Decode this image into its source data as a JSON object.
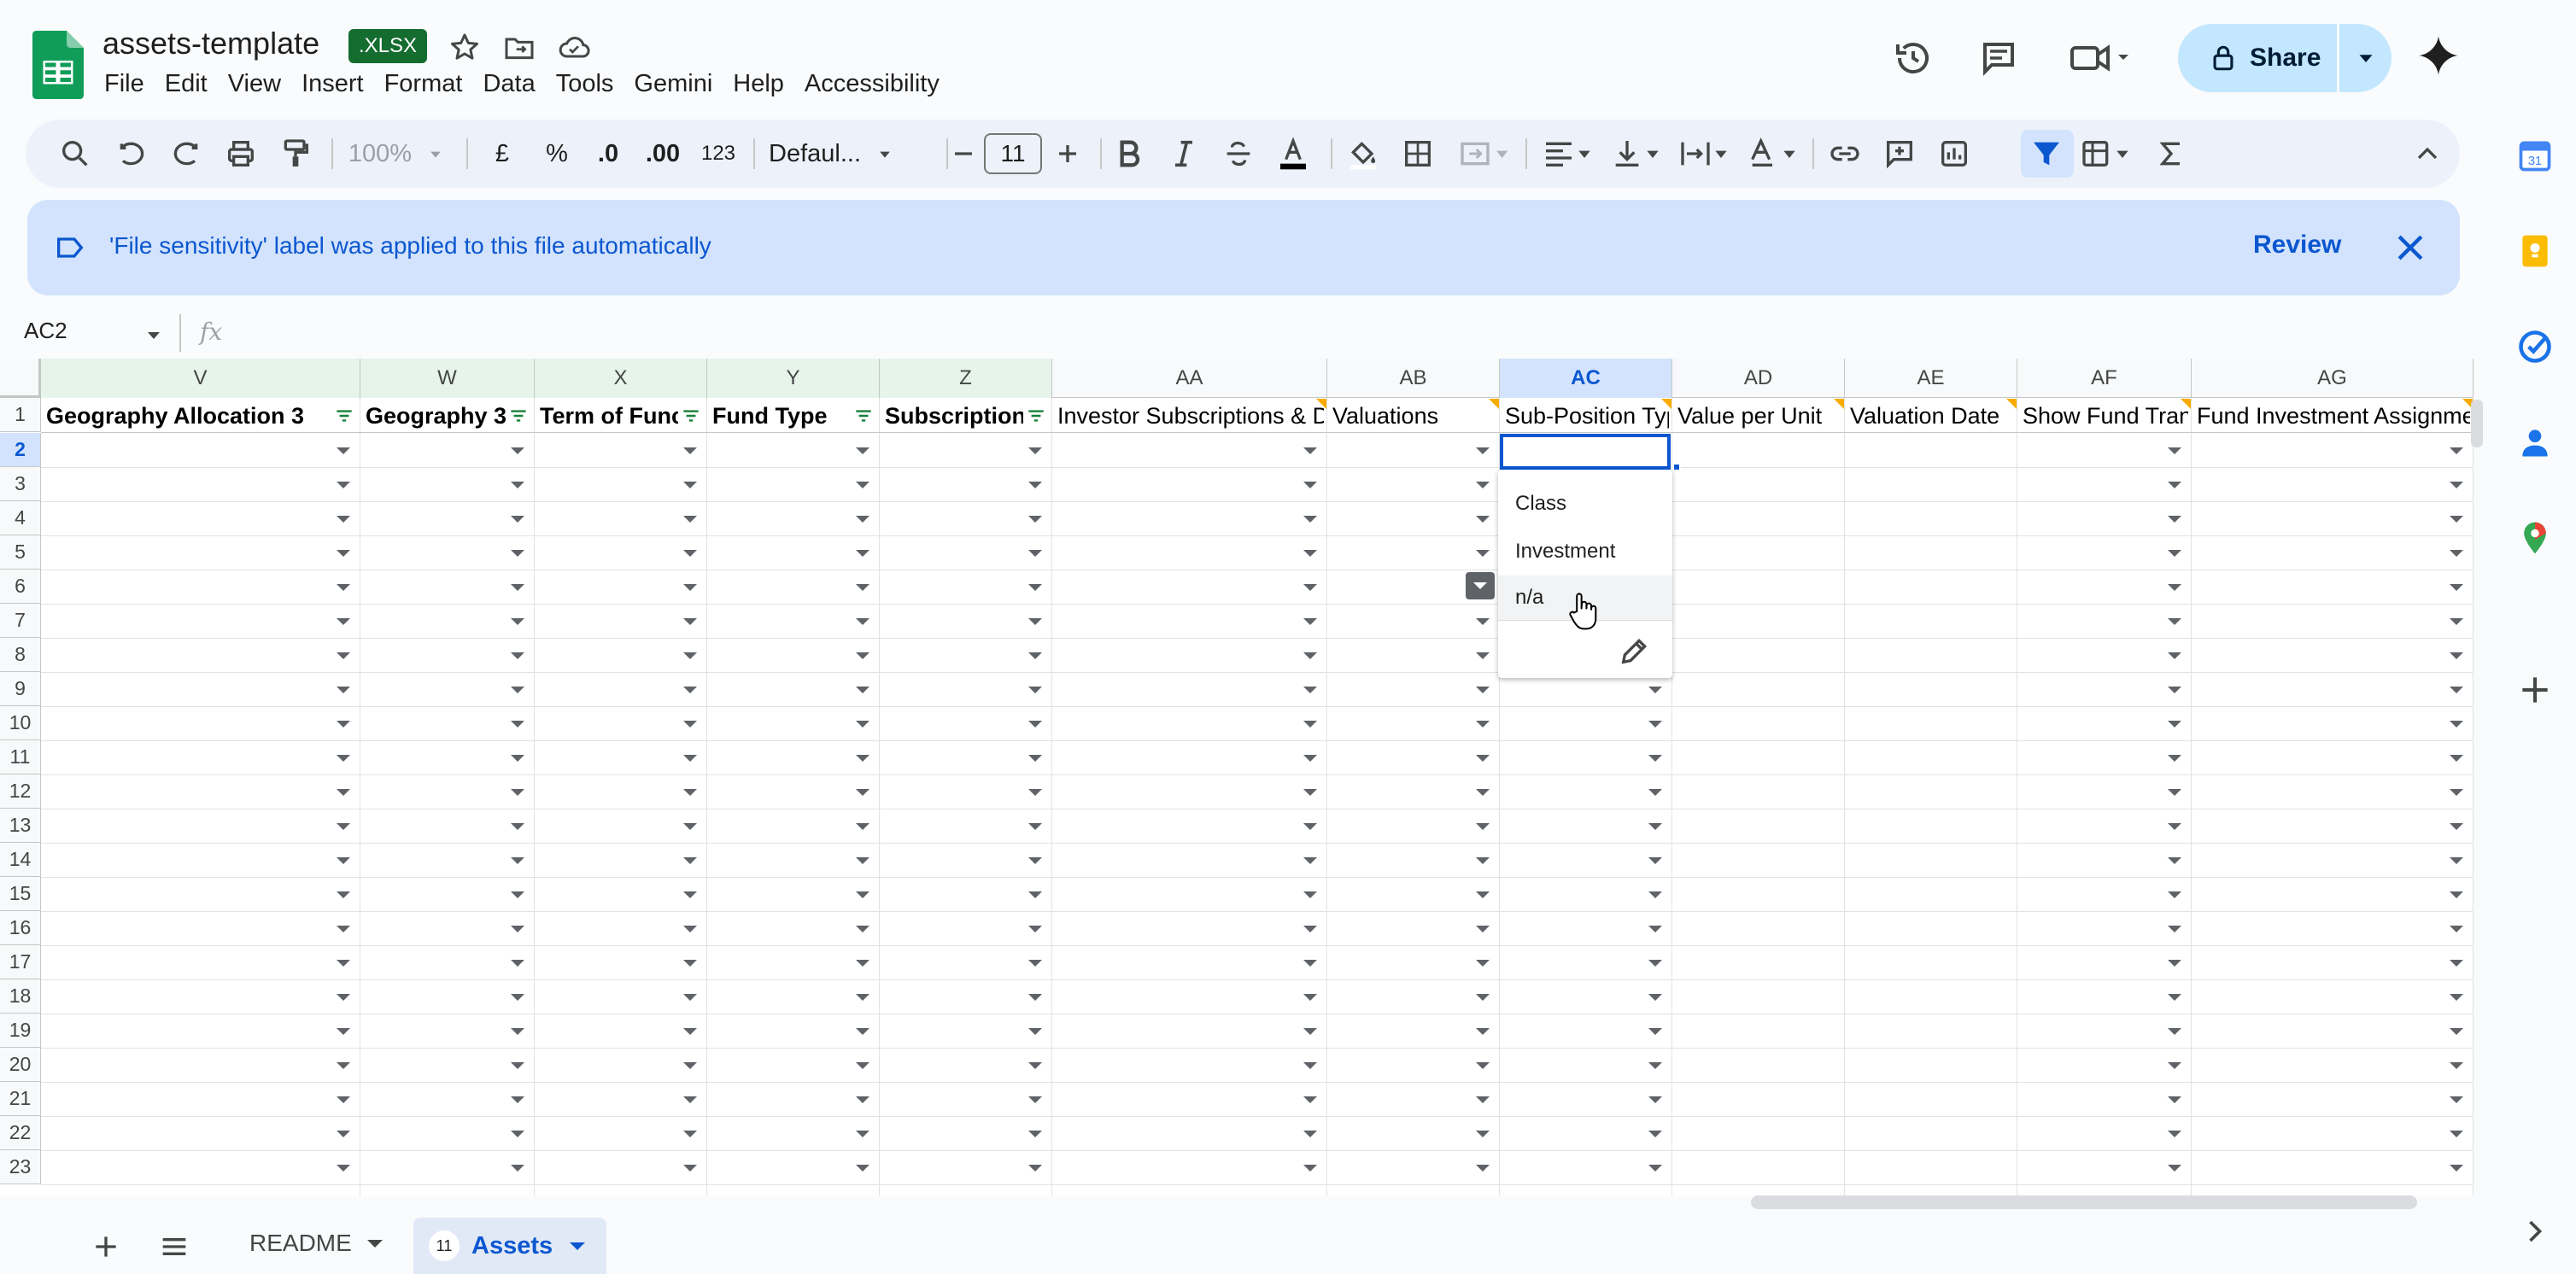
{
  "app": {
    "doc_title": "assets-template",
    "file_badge": ".XLSX",
    "menu": [
      "File",
      "Edit",
      "View",
      "Insert",
      "Format",
      "Data",
      "Tools",
      "Gemini",
      "Help",
      "Accessibility"
    ],
    "share_label": "Share"
  },
  "toolbar": {
    "zoom": "100%",
    "currency": "£",
    "percent": "%",
    "decrease_decimals": ".0",
    "increase_decimals": ".00",
    "number_format": "123",
    "font": "Defaul...",
    "font_size": "11"
  },
  "banner": {
    "message": "'File sensitivity' label was applied to this file automatically",
    "review_label": "Review"
  },
  "formula_bar": {
    "cell_ref": "AC2",
    "fx": "fx"
  },
  "grid": {
    "columns": [
      {
        "letter": "V",
        "header": "Geography Allocation 3",
        "bold": true,
        "filter": true
      },
      {
        "letter": "W",
        "header": "Geography 3",
        "bold": true,
        "filter": true
      },
      {
        "letter": "X",
        "header": "Term of Func",
        "bold": true,
        "filter": true
      },
      {
        "letter": "Y",
        "header": "Fund Type",
        "bold": true,
        "filter": true
      },
      {
        "letter": "Z",
        "header": "Subscription",
        "bold": true,
        "filter": true
      },
      {
        "letter": "AA",
        "header": "Investor Subscriptions & D",
        "bold": false,
        "filter": false
      },
      {
        "letter": "AB",
        "header": "Valuations",
        "bold": false,
        "filter": false
      },
      {
        "letter": "AC",
        "header": "Sub-Position Typ",
        "bold": false,
        "filter": false
      },
      {
        "letter": "AD",
        "header": "Value per Unit",
        "bold": false,
        "filter": false
      },
      {
        "letter": "AE",
        "header": "Valuation Date",
        "bold": false,
        "filter": false
      },
      {
        "letter": "AF",
        "header": "Show Fund Tran:",
        "bold": false,
        "filter": false
      },
      {
        "letter": "AG",
        "header": "Fund Investment Assignme",
        "bold": false,
        "filter": false
      }
    ],
    "row_numbers": [
      "1",
      "2",
      "3",
      "4",
      "5",
      "6",
      "7",
      "8",
      "9",
      "10",
      "11",
      "12",
      "13",
      "14",
      "15",
      "16",
      "17",
      "18",
      "19",
      "20",
      "21",
      "22",
      "23"
    ],
    "selected_row": "2",
    "selected_column": "AC"
  },
  "dropdown": {
    "options": [
      "Class",
      "Investment",
      "n/a"
    ],
    "hovered": "n/a"
  },
  "sheets": {
    "tabs": [
      {
        "name": "README",
        "active": false
      },
      {
        "name": "Assets",
        "active": true,
        "badge": "11"
      }
    ]
  },
  "colors": {
    "accent": "#0b57d0",
    "share_bg": "#c2e7ff",
    "banner_bg": "#d3e3fd",
    "badge_green": "#146c2e",
    "note_marker": "#f9ab00"
  }
}
